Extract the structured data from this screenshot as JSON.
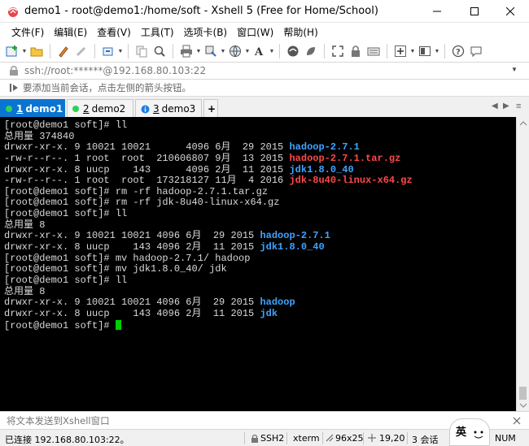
{
  "window": {
    "title": "demo1 - root@demo1:/home/soft - Xshell 5 (Free for Home/School)"
  },
  "menu": [
    "文件(F)",
    "编辑(E)",
    "查看(V)",
    "工具(T)",
    "选项卡(B)",
    "窗口(W)",
    "帮助(H)"
  ],
  "address": {
    "value": "ssh://root:******@192.168.80.103:22"
  },
  "hint": {
    "text": "要添加当前会话，点击左侧的箭头按钮。"
  },
  "tabs": [
    {
      "num": "1",
      "label": "demo1",
      "status_color": "#2fd15a"
    },
    {
      "num": "2",
      "label": "demo2",
      "status_color": "#2fd15a"
    },
    {
      "num": "3",
      "label": "demo3",
      "status_color": "#1a7fe0"
    }
  ],
  "tab_add": "+",
  "terminal": {
    "lines": [
      [
        {
          "t": "[root@demo1 soft]# ll",
          "c": ""
        }
      ],
      [
        {
          "t": "总用量 374840",
          "c": ""
        }
      ],
      [
        {
          "t": "drwxr-xr-x. 9 10021 10021      4096 6月  29 2015 ",
          "c": ""
        },
        {
          "t": "hadoop-2.7.1",
          "c": "blue"
        }
      ],
      [
        {
          "t": "-rw-r--r--. 1 root  root  210606807 9月  13 2015 ",
          "c": ""
        },
        {
          "t": "hadoop-2.7.1.tar.gz",
          "c": "red"
        }
      ],
      [
        {
          "t": "drwxr-xr-x. 8 uucp    143      4096 2月  11 2015 ",
          "c": ""
        },
        {
          "t": "jdk1.8.0_40",
          "c": "blue"
        }
      ],
      [
        {
          "t": "-rw-r--r--. 1 root  root  173218127 11月  4 2016 ",
          "c": ""
        },
        {
          "t": "jdk-8u40-linux-x64.gz",
          "c": "red"
        }
      ],
      [
        {
          "t": "[root@demo1 soft]# rm -rf hadoop-2.7.1.tar.gz",
          "c": ""
        }
      ],
      [
        {
          "t": "[root@demo1 soft]# rm -rf jdk-8u40-linux-x64.gz",
          "c": ""
        }
      ],
      [
        {
          "t": "[root@demo1 soft]# ll",
          "c": ""
        }
      ],
      [
        {
          "t": "总用量 8",
          "c": ""
        }
      ],
      [
        {
          "t": "drwxr-xr-x. 9 10021 10021 4096 6月  29 2015 ",
          "c": ""
        },
        {
          "t": "hadoop-2.7.1",
          "c": "blue"
        }
      ],
      [
        {
          "t": "drwxr-xr-x. 8 uucp    143 4096 2月  11 2015 ",
          "c": ""
        },
        {
          "t": "jdk1.8.0_40",
          "c": "blue"
        }
      ],
      [
        {
          "t": "[root@demo1 soft]# mv hadoop-2.7.1/ hadoop",
          "c": ""
        }
      ],
      [
        {
          "t": "[root@demo1 soft]# mv jdk1.8.0_40/ jdk",
          "c": ""
        }
      ],
      [
        {
          "t": "[root@demo1 soft]# ll",
          "c": ""
        }
      ],
      [
        {
          "t": "总用量 8",
          "c": ""
        }
      ],
      [
        {
          "t": "drwxr-xr-x. 9 10021 10021 4096 6月  29 2015 ",
          "c": ""
        },
        {
          "t": "hadoop",
          "c": "blue"
        }
      ],
      [
        {
          "t": "drwxr-xr-x. 8 uucp    143 4096 2月  11 2015 ",
          "c": ""
        },
        {
          "t": "jdk",
          "c": "blue"
        }
      ],
      [
        {
          "t": "[root@demo1 soft]# ",
          "c": ""
        },
        {
          "t": "",
          "c": "cursor"
        }
      ]
    ]
  },
  "send_bar": {
    "placeholder": "将文本发送到Xshell窗口"
  },
  "status": {
    "connection": "已连接 192.168.80.103:22。",
    "protocol": "SSH2",
    "term": "xterm",
    "size": "96x25",
    "cursor_pos": "19,20",
    "sessions": "3 会话",
    "num": "NUM",
    "ime": "英"
  }
}
